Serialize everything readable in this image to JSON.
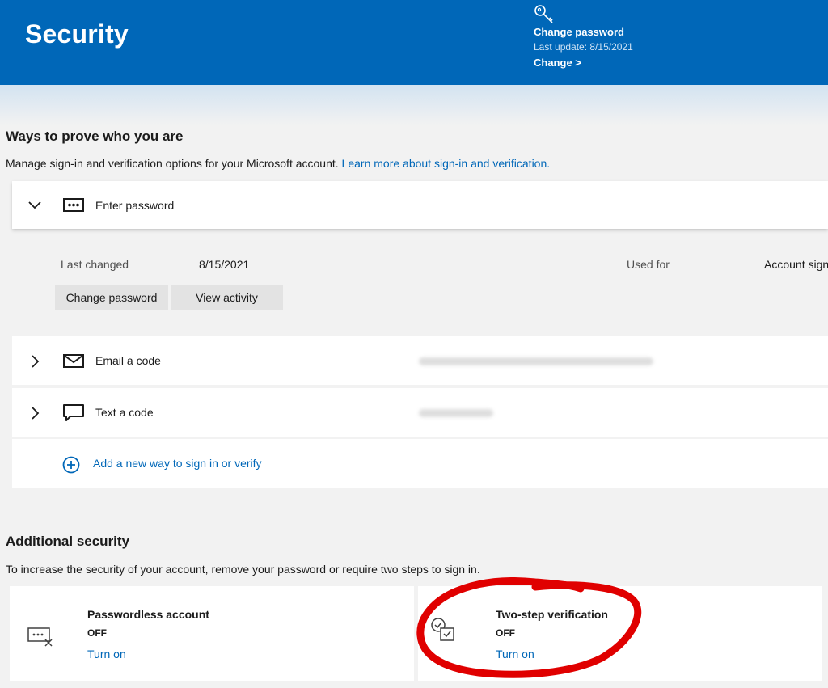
{
  "header": {
    "title": "Security",
    "change_password": {
      "title": "Change password",
      "last_update": "Last update: 8/15/2021",
      "link": "Change >"
    }
  },
  "ways": {
    "title": "Ways to prove who you are",
    "description": "Manage sign-in and verification options for your Microsoft account. ",
    "learn_more": "Learn more about sign-in and verification.",
    "password": {
      "label": "Enter password",
      "last_changed_label": "Last changed",
      "last_changed_value": "8/15/2021",
      "used_for_label": "Used for",
      "used_for_value": "Account sign-in",
      "change_btn": "Change password",
      "activity_btn": "View activity"
    },
    "email": {
      "label": "Email a code"
    },
    "text": {
      "label": "Text a code"
    },
    "add_new": "Add a new way to sign in or verify"
  },
  "additional": {
    "title": "Additional security",
    "description": "To increase the security of your account, remove your password or require two steps to sign in.",
    "passwordless": {
      "title": "Passwordless account",
      "status": "OFF",
      "link": "Turn on"
    },
    "two_step": {
      "title": "Two-step verification",
      "status": "OFF",
      "link": "Turn on"
    }
  },
  "colors": {
    "brand": "#0067b8",
    "annotation": "#e00000"
  }
}
